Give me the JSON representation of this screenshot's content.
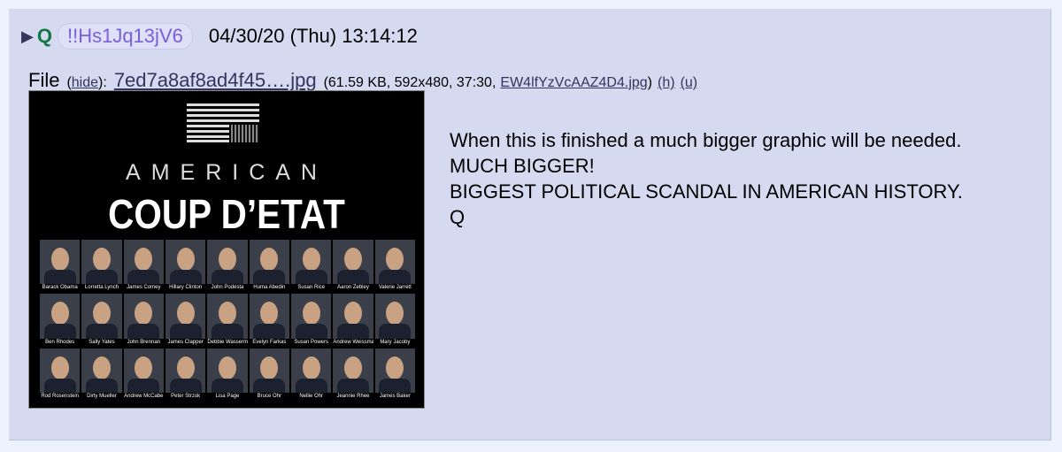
{
  "post": {
    "name": "Q",
    "tripcode": "!!Hs1Jq13jV6",
    "date": "04/30/20 (Thu) 13:14:12",
    "file": {
      "label": "File",
      "hide_text": "hide",
      "filename": "7ed7a8af8ad4f45….jpg",
      "info_prefix": "(61.59 KB, 592x480, 37:30,",
      "original_name": "EW4lfYzVcAAZ4D4.jpg",
      "h_link": "(h)",
      "u_link": "(u)"
    },
    "image": {
      "heading_small": "AMERICAN",
      "heading_big": "COUP D’ETAT",
      "people": [
        "Barack Obama",
        "Lorretta Lynch",
        "James Comey",
        "Hillary Clinton",
        "John Podesta",
        "Huma Abedin",
        "Susan Rice",
        "Aaron Zebley",
        "Valerie Jarrett",
        "Ben Rhodes",
        "Sally Yates",
        "John Brennan",
        "James Clapper",
        "Debbie Wasserman Schultz",
        "Evelyn Farkas",
        "Susan Powers",
        "Andrew Weissmann",
        "Mary Jacoby",
        "Rod Rosenstein",
        "Dirty Mueller",
        "Andrew McCabe",
        "Peter Strzok",
        "Lisa Page",
        "Bruce Ohr",
        "Nellie Ohr",
        "Jeannie Rhee",
        "James Baker"
      ]
    },
    "message_lines": [
      "When this is finished a much bigger graphic will be needed.",
      "MUCH BIGGER!",
      "BIGGEST POLITICAL SCANDAL IN AMERICAN HISTORY.",
      "Q"
    ]
  },
  "colors": {
    "page_bg": "#eef2ff",
    "post_bg": "#d6daf0",
    "name": "#117743",
    "link": "#34345c",
    "tripcode": "#7a5fd6"
  }
}
